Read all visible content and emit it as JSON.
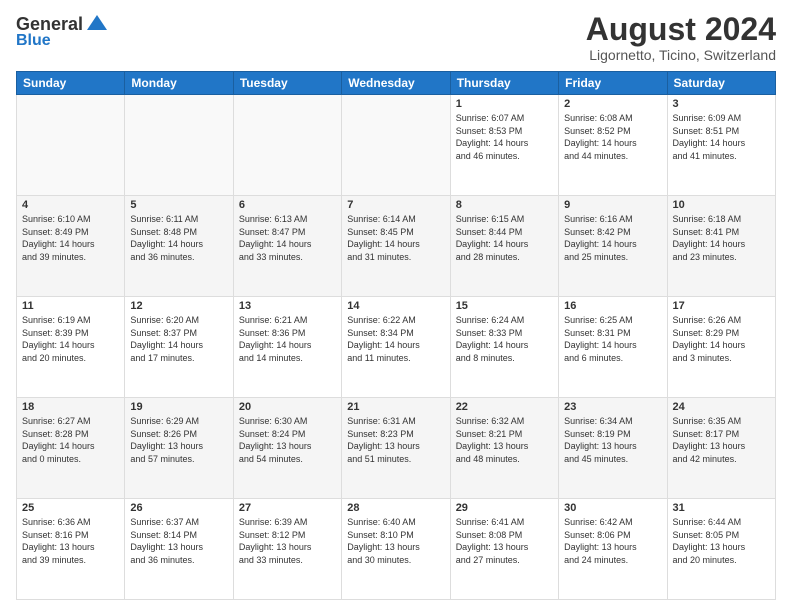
{
  "header": {
    "logo_general": "General",
    "logo_blue": "Blue",
    "month_year": "August 2024",
    "location": "Ligornetto, Ticino, Switzerland"
  },
  "days_of_week": [
    "Sunday",
    "Monday",
    "Tuesday",
    "Wednesday",
    "Thursday",
    "Friday",
    "Saturday"
  ],
  "weeks": [
    [
      {
        "day": "",
        "info": ""
      },
      {
        "day": "",
        "info": ""
      },
      {
        "day": "",
        "info": ""
      },
      {
        "day": "",
        "info": ""
      },
      {
        "day": "1",
        "info": "Sunrise: 6:07 AM\nSunset: 8:53 PM\nDaylight: 14 hours\nand 46 minutes."
      },
      {
        "day": "2",
        "info": "Sunrise: 6:08 AM\nSunset: 8:52 PM\nDaylight: 14 hours\nand 44 minutes."
      },
      {
        "day": "3",
        "info": "Sunrise: 6:09 AM\nSunset: 8:51 PM\nDaylight: 14 hours\nand 41 minutes."
      }
    ],
    [
      {
        "day": "4",
        "info": "Sunrise: 6:10 AM\nSunset: 8:49 PM\nDaylight: 14 hours\nand 39 minutes."
      },
      {
        "day": "5",
        "info": "Sunrise: 6:11 AM\nSunset: 8:48 PM\nDaylight: 14 hours\nand 36 minutes."
      },
      {
        "day": "6",
        "info": "Sunrise: 6:13 AM\nSunset: 8:47 PM\nDaylight: 14 hours\nand 33 minutes."
      },
      {
        "day": "7",
        "info": "Sunrise: 6:14 AM\nSunset: 8:45 PM\nDaylight: 14 hours\nand 31 minutes."
      },
      {
        "day": "8",
        "info": "Sunrise: 6:15 AM\nSunset: 8:44 PM\nDaylight: 14 hours\nand 28 minutes."
      },
      {
        "day": "9",
        "info": "Sunrise: 6:16 AM\nSunset: 8:42 PM\nDaylight: 14 hours\nand 25 minutes."
      },
      {
        "day": "10",
        "info": "Sunrise: 6:18 AM\nSunset: 8:41 PM\nDaylight: 14 hours\nand 23 minutes."
      }
    ],
    [
      {
        "day": "11",
        "info": "Sunrise: 6:19 AM\nSunset: 8:39 PM\nDaylight: 14 hours\nand 20 minutes."
      },
      {
        "day": "12",
        "info": "Sunrise: 6:20 AM\nSunset: 8:37 PM\nDaylight: 14 hours\nand 17 minutes."
      },
      {
        "day": "13",
        "info": "Sunrise: 6:21 AM\nSunset: 8:36 PM\nDaylight: 14 hours\nand 14 minutes."
      },
      {
        "day": "14",
        "info": "Sunrise: 6:22 AM\nSunset: 8:34 PM\nDaylight: 14 hours\nand 11 minutes."
      },
      {
        "day": "15",
        "info": "Sunrise: 6:24 AM\nSunset: 8:33 PM\nDaylight: 14 hours\nand 8 minutes."
      },
      {
        "day": "16",
        "info": "Sunrise: 6:25 AM\nSunset: 8:31 PM\nDaylight: 14 hours\nand 6 minutes."
      },
      {
        "day": "17",
        "info": "Sunrise: 6:26 AM\nSunset: 8:29 PM\nDaylight: 14 hours\nand 3 minutes."
      }
    ],
    [
      {
        "day": "18",
        "info": "Sunrise: 6:27 AM\nSunset: 8:28 PM\nDaylight: 14 hours\nand 0 minutes."
      },
      {
        "day": "19",
        "info": "Sunrise: 6:29 AM\nSunset: 8:26 PM\nDaylight: 13 hours\nand 57 minutes."
      },
      {
        "day": "20",
        "info": "Sunrise: 6:30 AM\nSunset: 8:24 PM\nDaylight: 13 hours\nand 54 minutes."
      },
      {
        "day": "21",
        "info": "Sunrise: 6:31 AM\nSunset: 8:23 PM\nDaylight: 13 hours\nand 51 minutes."
      },
      {
        "day": "22",
        "info": "Sunrise: 6:32 AM\nSunset: 8:21 PM\nDaylight: 13 hours\nand 48 minutes."
      },
      {
        "day": "23",
        "info": "Sunrise: 6:34 AM\nSunset: 8:19 PM\nDaylight: 13 hours\nand 45 minutes."
      },
      {
        "day": "24",
        "info": "Sunrise: 6:35 AM\nSunset: 8:17 PM\nDaylight: 13 hours\nand 42 minutes."
      }
    ],
    [
      {
        "day": "25",
        "info": "Sunrise: 6:36 AM\nSunset: 8:16 PM\nDaylight: 13 hours\nand 39 minutes."
      },
      {
        "day": "26",
        "info": "Sunrise: 6:37 AM\nSunset: 8:14 PM\nDaylight: 13 hours\nand 36 minutes."
      },
      {
        "day": "27",
        "info": "Sunrise: 6:39 AM\nSunset: 8:12 PM\nDaylight: 13 hours\nand 33 minutes."
      },
      {
        "day": "28",
        "info": "Sunrise: 6:40 AM\nSunset: 8:10 PM\nDaylight: 13 hours\nand 30 minutes."
      },
      {
        "day": "29",
        "info": "Sunrise: 6:41 AM\nSunset: 8:08 PM\nDaylight: 13 hours\nand 27 minutes."
      },
      {
        "day": "30",
        "info": "Sunrise: 6:42 AM\nSunset: 8:06 PM\nDaylight: 13 hours\nand 24 minutes."
      },
      {
        "day": "31",
        "info": "Sunrise: 6:44 AM\nSunset: 8:05 PM\nDaylight: 13 hours\nand 20 minutes."
      }
    ]
  ]
}
